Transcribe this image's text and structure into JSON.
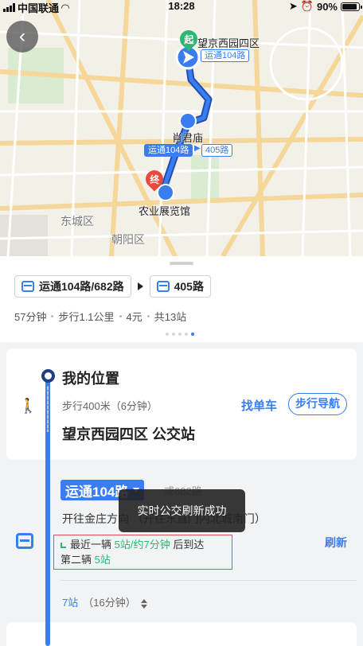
{
  "status_bar": {
    "carrier": "中国联通",
    "time": "18:28",
    "battery": "90%",
    "battery_level": 0.9
  },
  "map": {
    "back_label": "‹",
    "start_badge": "起",
    "end_badge": "终",
    "start_stop": "望京西园四区",
    "start_route_chip": "运通104路",
    "transfer_stop": "肖君庙",
    "transfer_from": "运通104路",
    "transfer_to": "405路",
    "end_stop": "农业展览馆",
    "district_1": "东城区",
    "district_2": "朝阳区",
    "route_color": "#3a7df0"
  },
  "summary": {
    "route_1": "运通104路/682路",
    "route_2": "405路",
    "duration": "57分钟",
    "walk": "步行1.1公里",
    "fare": "4元",
    "stops_total": "共13站"
  },
  "segment_walk": {
    "origin": "我的位置",
    "walk_info": "步行400米（6分钟）",
    "find_bike": "找单车",
    "walk_nav": "步行导航",
    "boarding_stop": "望京西园四区 公交站"
  },
  "segment_bus": {
    "route_name": "运通104路",
    "alt_route": "或682路",
    "direction": "开往金庄方向    （开往东直门内北城南门）",
    "next_bus_prefix": "最近一辆",
    "next_bus_value": "5站/约7分钟",
    "next_bus_suffix": "后到达",
    "second_bus_prefix": "第二辆",
    "second_bus_value": "5站",
    "refresh": "刷新",
    "stops": "7站",
    "stops_time": "（16分钟）"
  },
  "toast": "实时公交刷新成功",
  "colors": {
    "accent": "#3a7df0",
    "live": "#2bb673",
    "highlight_border": "#d9534f"
  }
}
